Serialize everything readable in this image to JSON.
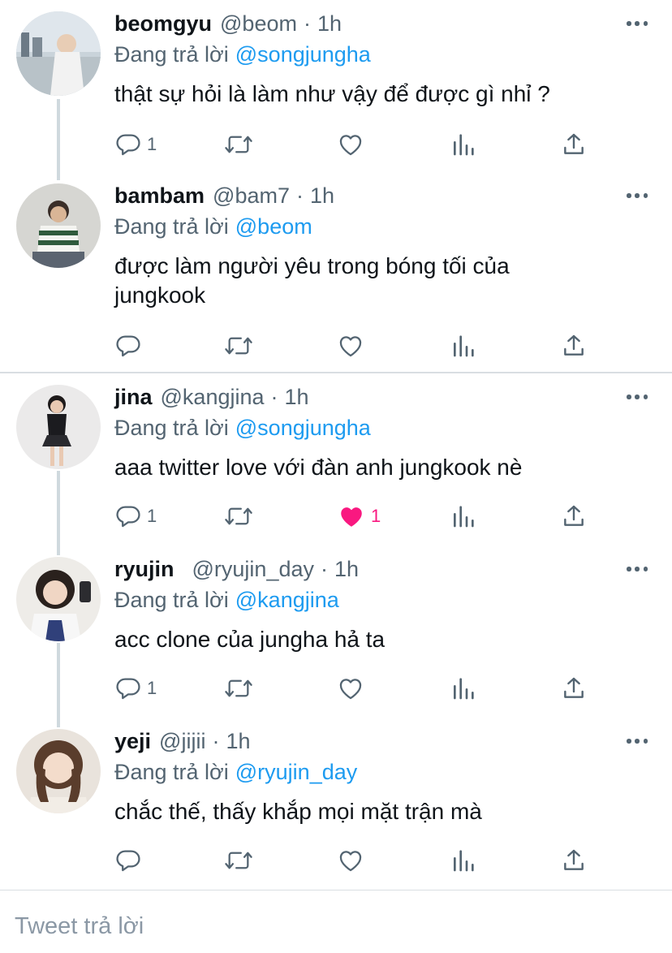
{
  "reply_prefix": "Đang trả lời",
  "tweets": [
    {
      "name": "beomgyu",
      "handle": "@beom",
      "time": "1h",
      "reply_to": "@songjungha",
      "text": "thật sự hỏi là làm như vậy để được gì nhỉ ?",
      "replies": "1",
      "likes": "",
      "liked": false
    },
    {
      "name": "bambam",
      "handle": "@bam7",
      "time": "1h",
      "reply_to": "@beom",
      "text": "được làm người yêu trong bóng tối của jungkook",
      "replies": "",
      "likes": "",
      "liked": false
    },
    {
      "name": "jina",
      "handle": "@kangjina",
      "time": "1h",
      "reply_to": "@songjungha",
      "text": "aaa twitter love với đàn anh jungkook nè",
      "replies": "1",
      "likes": "1",
      "liked": true
    },
    {
      "name": "ryujin",
      "handle": "@ryujin_day",
      "time": "1h",
      "reply_to": "@kangjina",
      "text": "acc clone của jungha hả ta",
      "replies": "1",
      "likes": "",
      "liked": false
    },
    {
      "name": "yeji",
      "handle": "@jijii",
      "time": "1h",
      "reply_to": "@ryujin_day",
      "text": "chắc thế, thấy khắp mọi mặt trận mà",
      "replies": "",
      "likes": "",
      "liked": false
    }
  ],
  "reply_box": {
    "placeholder": "Tweet trả lời"
  },
  "colors": {
    "mention": "#1d9bf0",
    "secondary_text": "#536471",
    "like_active": "#f91880",
    "thread_line": "#cfd9de"
  },
  "icons": [
    "reply-icon",
    "retweet-icon",
    "like-icon",
    "analytics-icon",
    "share-icon",
    "more-icon"
  ]
}
